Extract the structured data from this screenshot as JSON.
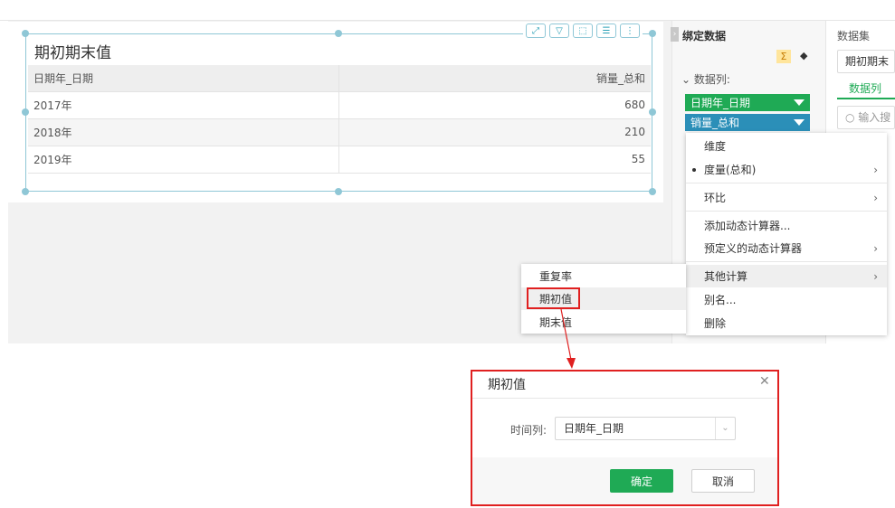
{
  "widget": {
    "title": "期初期末值",
    "table": {
      "headers": [
        "日期年_日期",
        "销量_总和"
      ],
      "rows": [
        [
          "2017年",
          "680"
        ],
        [
          "2018年",
          "210"
        ],
        [
          "2019年",
          "55"
        ]
      ]
    },
    "toolbar_icons": [
      "expand-icon",
      "filter-icon",
      "select-icon",
      "list-icon",
      "more-icon"
    ]
  },
  "binding": {
    "title": "绑定数据",
    "data_columns_label": "数据列:",
    "fields": [
      "日期年_日期",
      "销量_总和"
    ],
    "colors": {
      "dimension": "#1faa55",
      "measure": "#2b8fb8"
    }
  },
  "dataset": {
    "title": "数据集",
    "selected": "期初期末",
    "tab": "数据列",
    "search_placeholder": "输入搜"
  },
  "context_menu": {
    "items": [
      {
        "label": "维度",
        "submenu": false
      },
      {
        "label": "度量(总和)",
        "submenu": true,
        "checked": true
      },
      {
        "label": "环比",
        "submenu": true
      },
      {
        "label": "添加动态计算器...",
        "submenu": false
      },
      {
        "label": "预定义的动态计算器",
        "submenu": true
      },
      {
        "label": "其他计算",
        "submenu": true,
        "highlighted": true
      },
      {
        "label": "别名...",
        "submenu": false
      },
      {
        "label": "删除",
        "submenu": false
      }
    ]
  },
  "sub_menu": {
    "items": [
      "重复率",
      "期初值",
      "期末值"
    ],
    "highlighted_index": 1
  },
  "dialog": {
    "title": "期初值",
    "field_label": "时间列:",
    "field_value": "日期年_日期",
    "ok_label": "确定",
    "cancel_label": "取消"
  },
  "accent": {
    "green": "#1faa55",
    "highlight_red": "#e02020",
    "selection": "#8fc7d6"
  }
}
